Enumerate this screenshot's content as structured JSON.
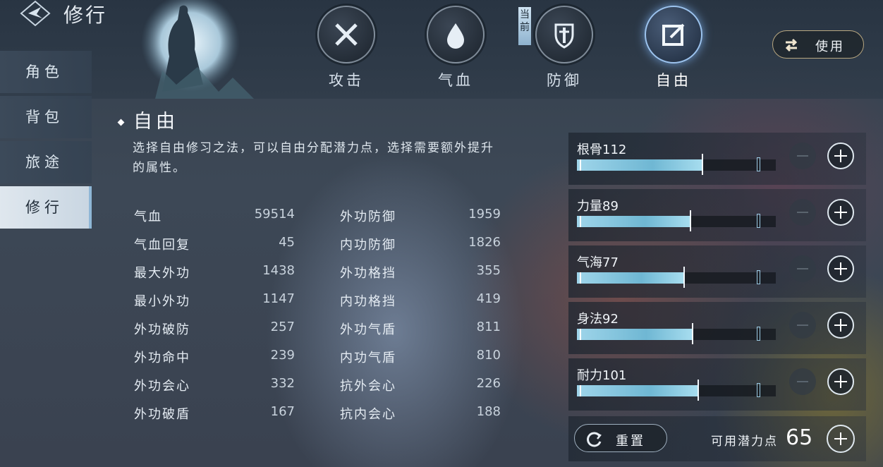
{
  "header": {
    "title": "修行"
  },
  "sidebar": {
    "items": [
      {
        "label": "角色"
      },
      {
        "label": "背包"
      },
      {
        "label": "旅途"
      },
      {
        "label": "修行",
        "active": true
      }
    ]
  },
  "tabs": [
    {
      "label": "攻击",
      "icon": "crossed-swords-icon"
    },
    {
      "label": "气血",
      "icon": "blood-drop-icon"
    },
    {
      "label": "防御",
      "icon": "shield-icon"
    },
    {
      "label": "自由",
      "icon": "edit-icon",
      "active": true
    }
  ],
  "current_tag": "当前",
  "use_button": {
    "label": "使用",
    "icon": "swap-icon"
  },
  "section": {
    "title": "自由",
    "description": "选择自由修习之法，可以自由分配潜力点，选择需要额外提升的属性。"
  },
  "stats_left": [
    {
      "name": "气血",
      "value": "59514"
    },
    {
      "name": "气血回复",
      "value": "45"
    },
    {
      "name": "最大外功",
      "value": "1438"
    },
    {
      "name": "最小外功",
      "value": "1147"
    },
    {
      "name": "外功破防",
      "value": "257"
    },
    {
      "name": "外功命中",
      "value": "239"
    },
    {
      "name": "外功会心",
      "value": "332"
    },
    {
      "name": "外功破盾",
      "value": "167"
    }
  ],
  "stats_right": [
    {
      "name": "外功防御",
      "value": "1959"
    },
    {
      "name": "内功防御",
      "value": "1826"
    },
    {
      "name": "外功格挡",
      "value": "355"
    },
    {
      "name": "内功格挡",
      "value": "419"
    },
    {
      "name": "外功气盾",
      "value": "811"
    },
    {
      "name": "内功气盾",
      "value": "810"
    },
    {
      "name": "抗外会心",
      "value": "226"
    },
    {
      "name": "抗内会心",
      "value": "188"
    }
  ],
  "attributes": [
    {
      "label": "根骨112",
      "fill": 0.63
    },
    {
      "label": "力量89",
      "fill": 0.57
    },
    {
      "label": "气海77",
      "fill": 0.54
    },
    {
      "label": "身法92",
      "fill": 0.58
    },
    {
      "label": "耐力101",
      "fill": 0.61
    }
  ],
  "footer": {
    "reset_label": "重置",
    "points_label": "可用潜力点",
    "points_value": "65"
  },
  "colors": {
    "bar_fill": "#7fc3dc",
    "active_tab_glow": "#9cc3ee",
    "use_button_border": "#b8a780"
  }
}
